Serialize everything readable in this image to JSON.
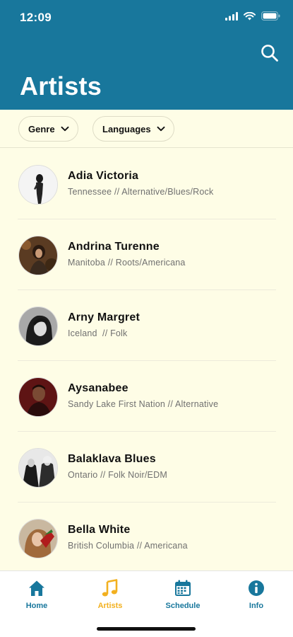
{
  "status": {
    "time": "12:09"
  },
  "header": {
    "title": "Artists"
  },
  "filters": [
    {
      "label": "Genre"
    },
    {
      "label": "Languages"
    }
  ],
  "artists": [
    {
      "name": "Adia Victoria",
      "subtitle": "Tennessee // Alternative/Blues/Rock"
    },
    {
      "name": "Andrina Turenne",
      "subtitle": "Manitoba // Roots/Americana"
    },
    {
      "name": "Arny Margret",
      "subtitle": "Iceland  // Folk"
    },
    {
      "name": "Aysanabee",
      "subtitle": "Sandy Lake First Nation // Alternative"
    },
    {
      "name": "Balaklava Blues",
      "subtitle": "Ontario // Folk Noir/EDM"
    },
    {
      "name": "Bella White",
      "subtitle": "British Columbia // Americana"
    }
  ],
  "tabs": [
    {
      "label": "Home",
      "icon": "home-icon",
      "active": false
    },
    {
      "label": "Artists",
      "icon": "music-note-icon",
      "active": true
    },
    {
      "label": "Schedule",
      "icon": "calendar-icon",
      "active": false
    },
    {
      "label": "Info",
      "icon": "info-icon",
      "active": false
    }
  ],
  "colors": {
    "header": "#18779c",
    "background": "#fefde6",
    "accent": "#f2b01f",
    "tab_inactive": "#18779c"
  }
}
